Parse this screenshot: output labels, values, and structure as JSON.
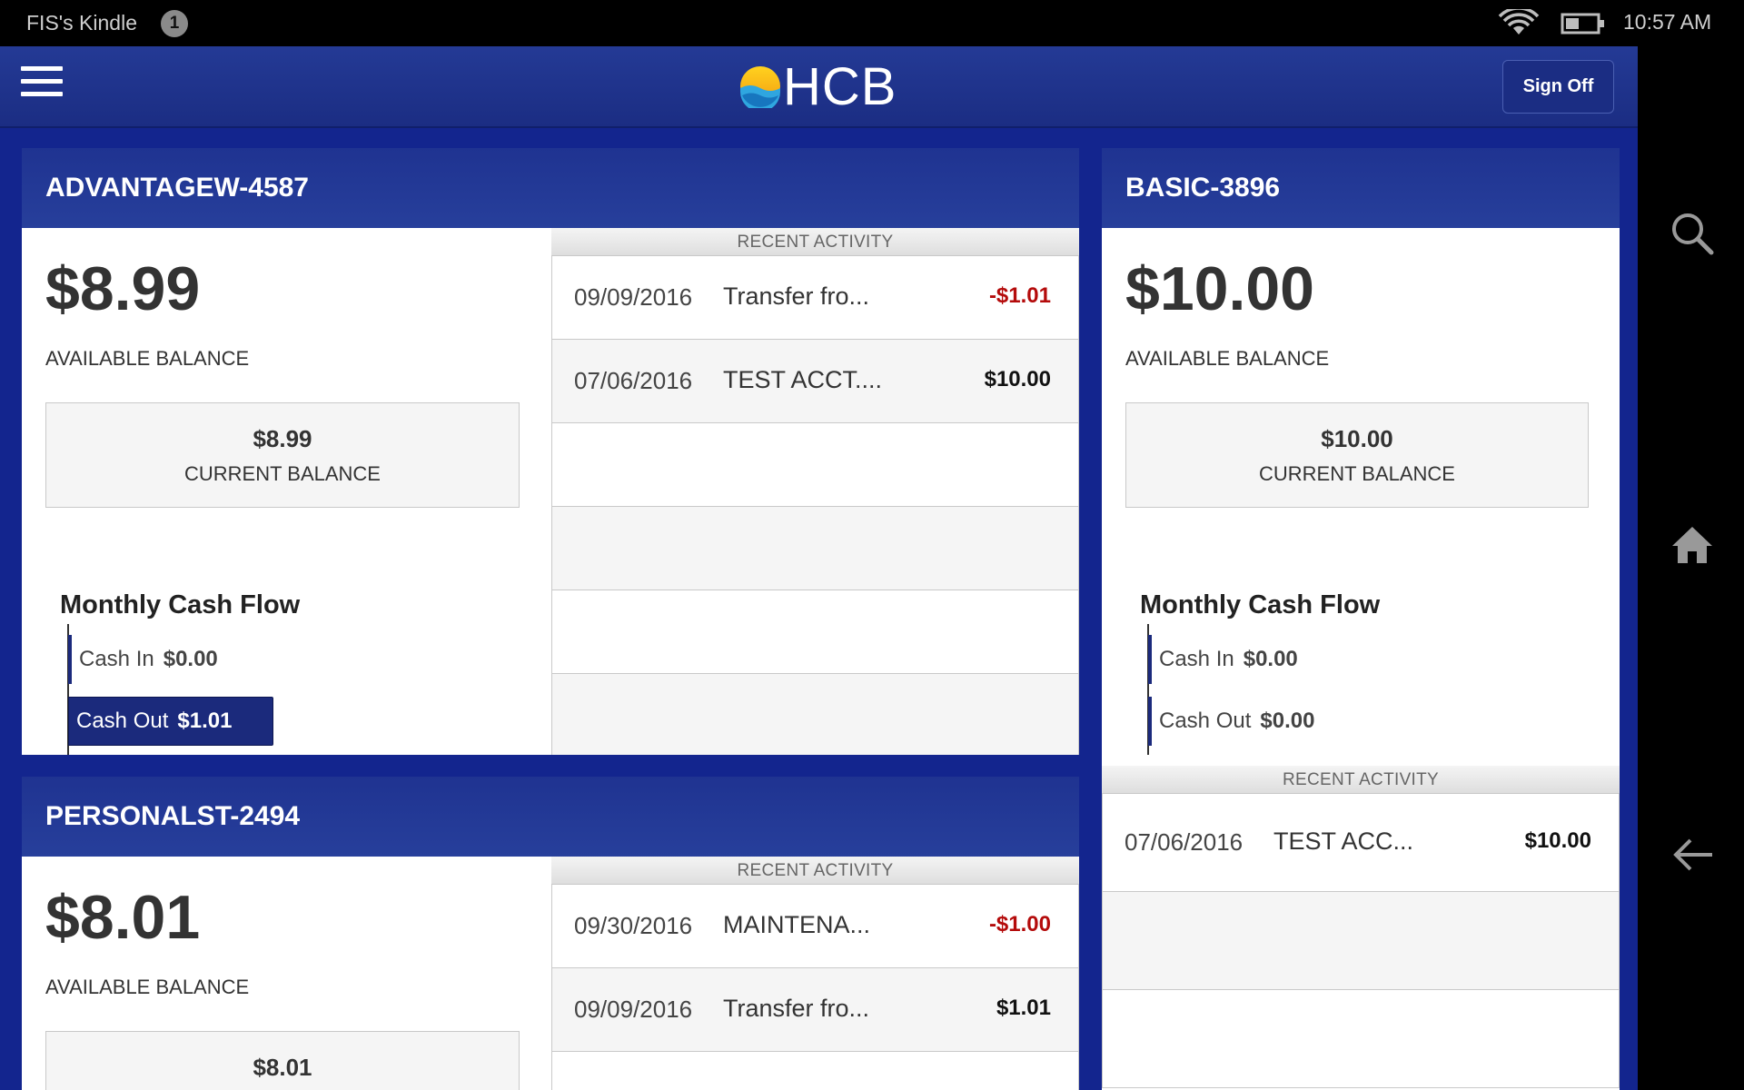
{
  "status_bar": {
    "device_name": "FIS's Kindle",
    "notification_count": "1",
    "time": "10:57 AM"
  },
  "header": {
    "logo_text": "HCB",
    "sign_off_label": "Sign Off"
  },
  "right_nav": {
    "icons": [
      "search-icon",
      "home-icon",
      "back-arrow-icon"
    ]
  },
  "colors": {
    "brand_blue": "#13258e",
    "negative_amount": "#b40b0b"
  },
  "accounts": [
    {
      "name": "ADVANTAGEW-4587",
      "available_balance": "$8.99",
      "available_label": "AVAILABLE BALANCE",
      "current_balance": "$8.99",
      "current_label": "CURRENT BALANCE",
      "cash_flow": {
        "title": "Monthly Cash Flow",
        "cash_in_label": "Cash In",
        "cash_in_value": "$0.00",
        "cash_out_label": "Cash Out",
        "cash_out_value": "$1.01"
      },
      "activity_title": "RECENT ACTIVITY",
      "activity": [
        {
          "date": "09/09/2016",
          "description": "Transfer fro...",
          "amount": "-$1.01"
        },
        {
          "date": "07/06/2016",
          "description": "TEST ACCT....",
          "amount": "$10.00"
        }
      ]
    },
    {
      "name": "BASIC-3896",
      "available_balance": "$10.00",
      "available_label": "AVAILABLE BALANCE",
      "current_balance": "$10.00",
      "current_label": "CURRENT BALANCE",
      "cash_flow": {
        "title": "Monthly Cash Flow",
        "cash_in_label": "Cash In",
        "cash_in_value": "$0.00",
        "cash_out_label": "Cash Out",
        "cash_out_value": "$0.00"
      },
      "activity_title": "RECENT ACTIVITY",
      "activity": [
        {
          "date": "07/06/2016",
          "description": "TEST ACC...",
          "amount": "$10.00"
        }
      ]
    },
    {
      "name": "PERSONALST-2494",
      "available_balance": "$8.01",
      "available_label": "AVAILABLE BALANCE",
      "current_balance": "$8.01",
      "activity_title": "RECENT ACTIVITY",
      "activity": [
        {
          "date": "09/30/2016",
          "description": "MAINTENA...",
          "amount": "-$1.00"
        },
        {
          "date": "09/09/2016",
          "description": "Transfer fro...",
          "amount": "$1.01"
        }
      ]
    }
  ]
}
